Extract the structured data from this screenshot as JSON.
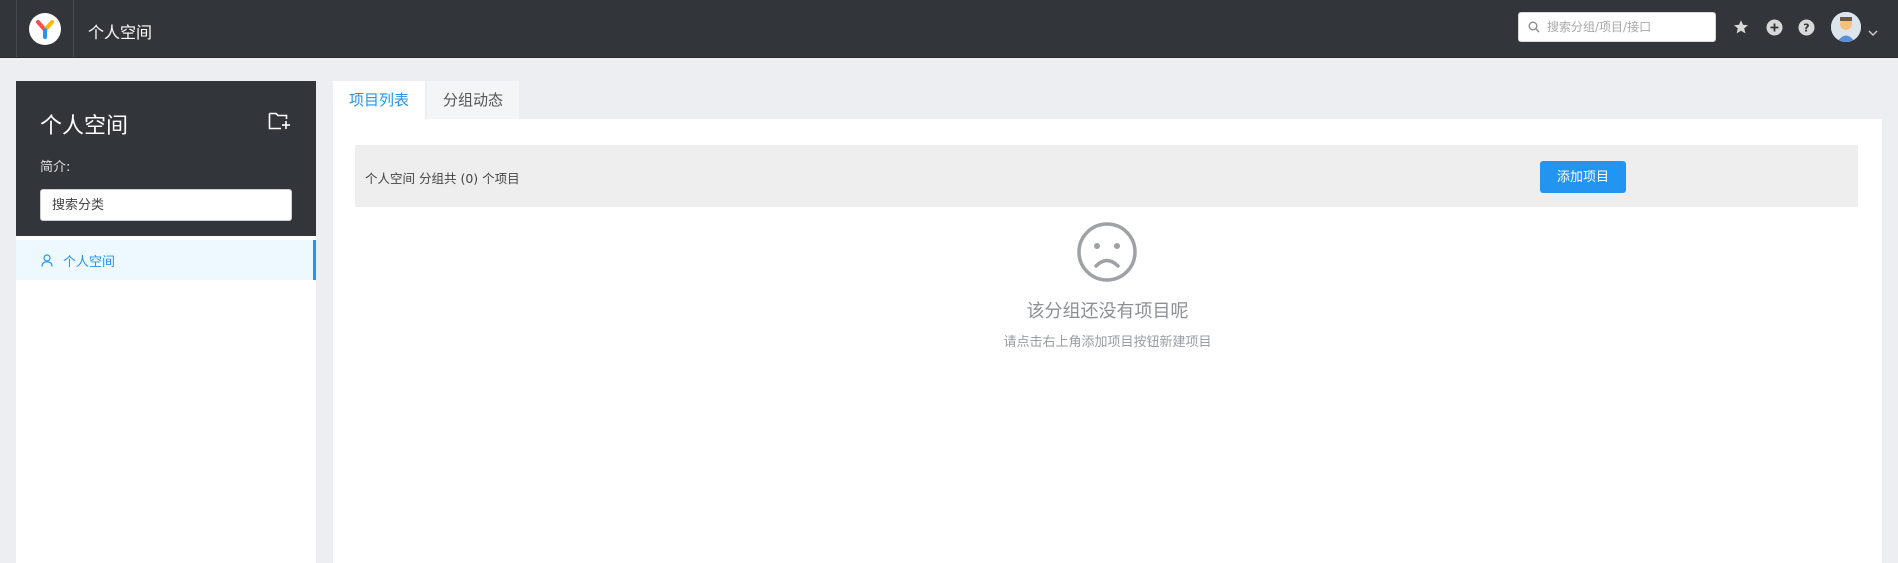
{
  "header": {
    "title": "个人空间",
    "search_placeholder": "搜索分组/项目/接口",
    "icons": [
      "star-icon",
      "plus-circle-icon",
      "help-icon",
      "avatar",
      "chevron-down-icon"
    ]
  },
  "sidebar": {
    "title": "个人空间",
    "intro_label": "简介:",
    "search_placeholder": "搜索分类",
    "items": [
      {
        "label": "个人空间",
        "icon": "user-icon",
        "active": true
      }
    ]
  },
  "tabs": [
    {
      "label": "项目列表",
      "active": true
    },
    {
      "label": "分组动态",
      "active": false
    }
  ],
  "project_list": {
    "summary": "个人空间 分组共 (0) 个项目",
    "add_button": "添加项目",
    "empty_title": "该分组还没有项目呢",
    "empty_subtitle": "请点击右上角添加项目按钮新建项目"
  },
  "colors": {
    "accent": "#2395f1",
    "topbar": "#32363a",
    "background": "#eceef1"
  }
}
